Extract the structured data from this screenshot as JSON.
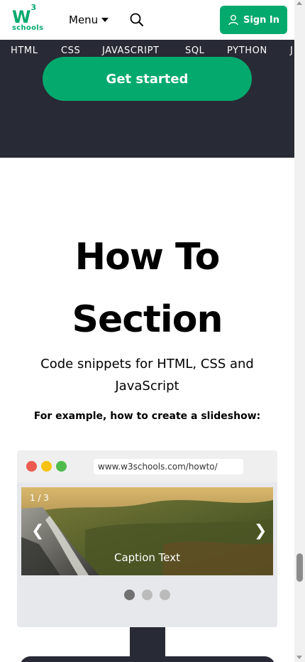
{
  "header": {
    "logo_mark": "W",
    "logo_sup": "3",
    "logo_word": "schools",
    "menu_label": "Menu",
    "signin_label": "Sign In"
  },
  "nav": {
    "items": [
      "HTML",
      "CSS",
      "JAVASCRIPT",
      "SQL",
      "PYTHON",
      "J"
    ]
  },
  "hero": {
    "cta_label": "Get started"
  },
  "main": {
    "title_line1": "How To",
    "title_line2": "Section",
    "subtitle": "Code snippets for HTML, CSS and JavaScript",
    "example_text": "For example, how to create a slideshow:"
  },
  "demo": {
    "url": "www.w3schools.com/howto/",
    "slide_number": "1 / 3",
    "caption": "Caption Text",
    "prev_arrow": "❮",
    "next_arrow": "❯",
    "active_slide": 1,
    "total_slides": 3
  },
  "colors": {
    "brand_green": "#04AA6D",
    "dark_bg": "#282A35",
    "dot_red": "#EC5B4D",
    "dot_yellow": "#F6C20F",
    "dot_green": "#4EBB4B",
    "indicator_active": "#717171",
    "indicator_inactive": "#BBBBBB"
  },
  "icons": {
    "search": "search-icon",
    "user": "user-icon",
    "caret": "caret-down-icon"
  }
}
